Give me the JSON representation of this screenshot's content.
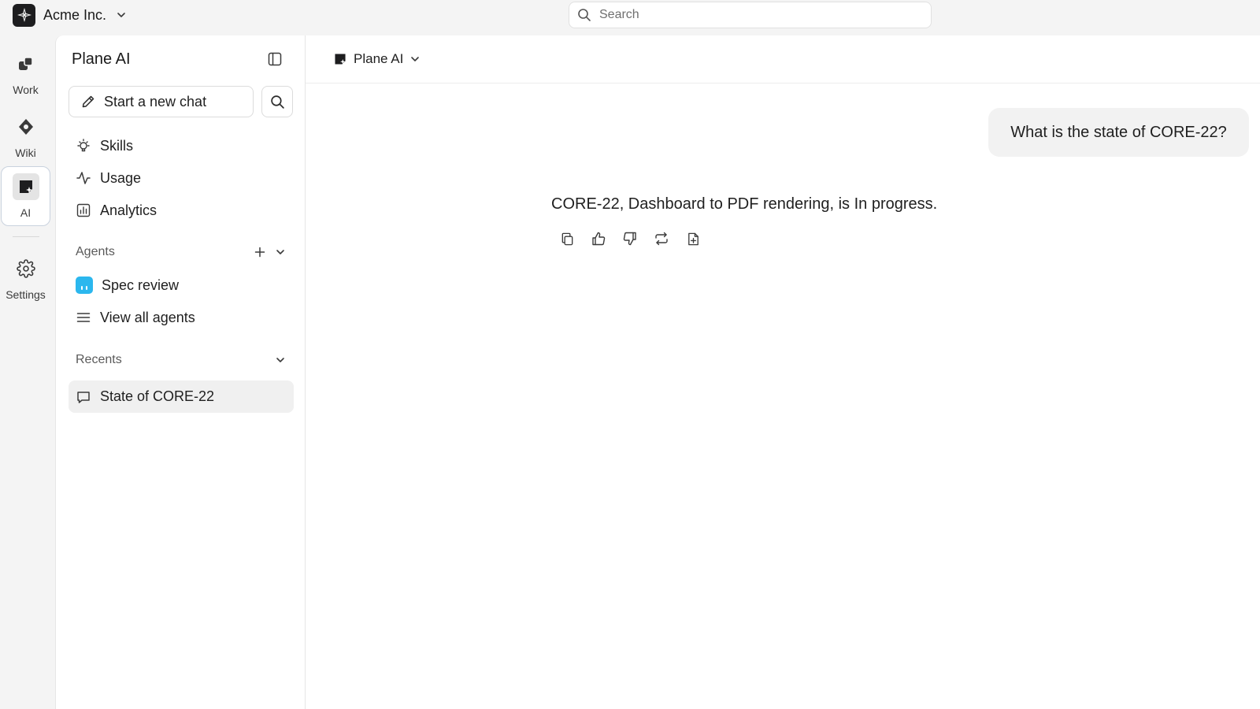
{
  "workspace": {
    "name": "Acme Inc."
  },
  "search": {
    "placeholder": "Search"
  },
  "rail": {
    "items": [
      {
        "label": "Work",
        "icon": "work-icon"
      },
      {
        "label": "Wiki",
        "icon": "wiki-icon"
      },
      {
        "label": "AI",
        "icon": "ai-icon",
        "active": true
      },
      {
        "label": "Settings",
        "icon": "gear-icon"
      }
    ]
  },
  "sidebar": {
    "title": "Plane AI",
    "new_chat_label": "Start a new chat",
    "nav": [
      {
        "label": "Skills",
        "icon": "lightbulb-icon"
      },
      {
        "label": "Usage",
        "icon": "activity-icon"
      },
      {
        "label": "Analytics",
        "icon": "bar-chart-icon"
      }
    ],
    "agents": {
      "heading": "Agents",
      "items": [
        {
          "label": "Spec review",
          "icon": "agent-avatar-icon"
        }
      ],
      "view_all_label": "View all agents"
    },
    "recents": {
      "heading": "Recents",
      "items": [
        {
          "label": "State of CORE-22",
          "icon": "chat-bubble-icon",
          "selected": true
        }
      ]
    }
  },
  "main": {
    "model_label": "Plane AI",
    "user_message": "What is the state of CORE-22?",
    "ai_response": "CORE-22, Dashboard to PDF rendering, is In progress.",
    "response_actions": [
      "copy-icon",
      "thumbs-up-icon",
      "thumbs-down-icon",
      "retry-icon",
      "add-to-page-icon"
    ]
  },
  "colors": {
    "background": "#f4f4f4",
    "panel": "#ffffff",
    "agent_avatar": "#2bb7ee",
    "active_rail_border": "#c9d2de"
  }
}
